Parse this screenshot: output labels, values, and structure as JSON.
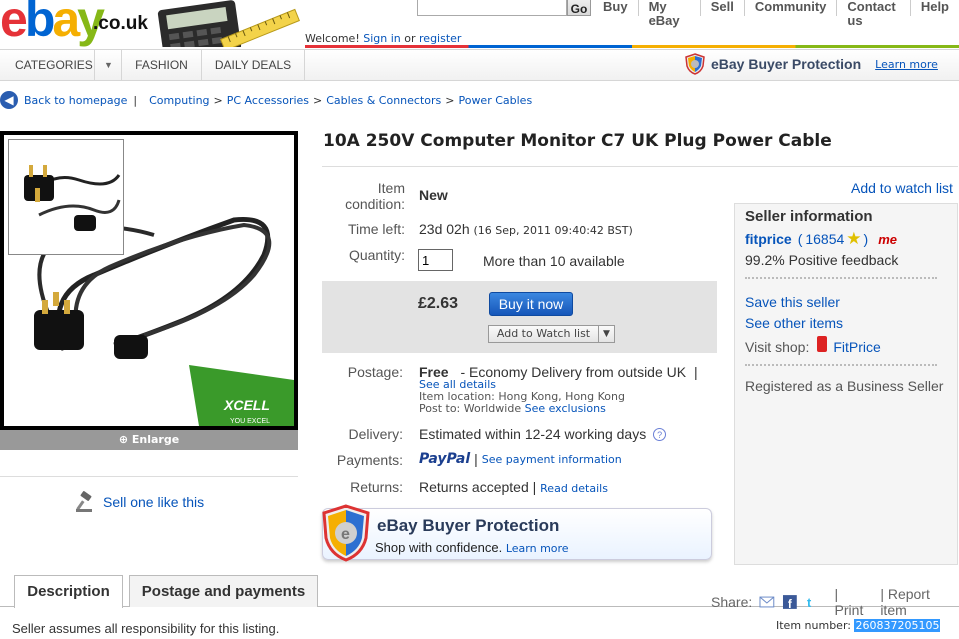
{
  "header": {
    "logo_letters": [
      "e",
      "b",
      "a",
      "y"
    ],
    "logo_suffix": ".co.uk",
    "search_button": "Go",
    "top_nav": [
      "Buy",
      "My eBay",
      "Sell",
      "Community",
      "Contact us",
      "Help"
    ],
    "welcome_prefix": "Welcome!",
    "welcome_signin": "Sign in",
    "welcome_or": "or",
    "welcome_register": "register"
  },
  "category_bar": {
    "categories_label": "CATEGORIES",
    "fashion_label": "FASHION",
    "daily_deals_label": "DAILY DEALS",
    "buyer_protection_label": "eBay Buyer Protection",
    "learn_more": "Learn more"
  },
  "breadcrumb": {
    "back_label": "Back to homepage",
    "items": [
      "Computing",
      "PC Accessories",
      "Cables & Connectors",
      "Power Cables"
    ],
    "separator": ">"
  },
  "image_panel": {
    "enlarge_label": "Enlarge",
    "brand_text": "XCELL",
    "brand_tagline": "YOU EXCEL",
    "sell_one_label": "Sell one like this"
  },
  "listing": {
    "title": "10A 250V Computer Monitor C7 UK Plug Power Cable",
    "condition_label_1": "Item",
    "condition_label_2": "condition:",
    "condition_value": "New",
    "time_left_label": "Time left:",
    "time_left_value": "23d 02h",
    "time_left_date": "(16 Sep, 2011 09:40:42 BST)",
    "quantity_label": "Quantity:",
    "quantity_value": "1",
    "availability": "More than 10 available",
    "price": "£2.63",
    "buy_now": "Buy it now",
    "add_to_watch": "Add to Watch list",
    "postage_label": "Postage:",
    "postage_value": "Free",
    "postage_service": "- Economy Delivery from outside UK",
    "postage_pipe": "|",
    "see_all_details": "See all details",
    "item_location": "Item location: Hong Kong, Hong Kong",
    "post_to": "Post to: Worldwide",
    "see_exclusions": "See exclusions",
    "delivery_label": "Delivery:",
    "delivery_value": "Estimated within 12-24 working days",
    "payments_label": "Payments:",
    "paypal": "PayPal",
    "payments_pipe": "|",
    "see_payment_info": "See payment information",
    "returns_label": "Returns:",
    "returns_value": "Returns accepted",
    "returns_pipe": "|",
    "read_details": "Read details"
  },
  "buyer_protection_banner": {
    "title": "eBay Buyer Protection",
    "subtitle": "Shop with confidence.",
    "learn_more": "Learn more"
  },
  "seller": {
    "add_to_watch_list": "Add to watch list",
    "heading": "Seller information",
    "name": "fitprice",
    "open_paren": "(",
    "feedback_score": "16854",
    "close_paren": ")",
    "me_badge": "me",
    "positive_feedback": "99.2% Positive feedback",
    "save_seller": "Save this seller",
    "see_other_items": "See other items",
    "visit_shop_label": "Visit shop:",
    "shop_name": "FitPrice",
    "registered": "Registered as a Business Seller"
  },
  "tabs": {
    "description": "Description",
    "postage_payments": "Postage and payments"
  },
  "share_bar": {
    "share_label": "Share:",
    "print": "| Print",
    "report": "| Report item"
  },
  "footer": {
    "responsibility": "Seller assumes all responsibility for this listing.",
    "item_number_label": "Item number:",
    "item_number": "260837205105"
  },
  "colors": {
    "link": "#0654ba",
    "buy_button": "#1f64c8",
    "price_band": "#e3e3e3",
    "seller_box": "#f5f5f5"
  }
}
